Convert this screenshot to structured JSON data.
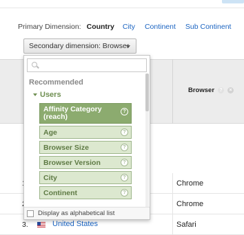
{
  "primary_dimension": {
    "label": "Primary Dimension:",
    "selected": "Country",
    "options": [
      "City",
      "Continent",
      "Sub Continent"
    ]
  },
  "secondary_dimension": {
    "button_label": "Secondary dimension: Browser"
  },
  "dropdown": {
    "search_placeholder": "",
    "section_title": "Recommended",
    "group_title": "Users",
    "items": [
      {
        "label": "Affinity Category (reach)",
        "active": true
      },
      {
        "label": "Age",
        "active": false
      },
      {
        "label": "Browser Size",
        "active": false
      },
      {
        "label": "Browser Version",
        "active": false
      },
      {
        "label": "City",
        "active": false
      },
      {
        "label": "Continent",
        "active": false
      }
    ],
    "footer_checkbox_label": "Display as alphabetical list"
  },
  "table": {
    "header_browser": "Browser",
    "rows": [
      {
        "num": "1.",
        "country": "",
        "browser": "Chrome"
      },
      {
        "num": "2.",
        "country": "",
        "browser": "Chrome"
      },
      {
        "num": "3.",
        "country": "United States",
        "browser": "Safari"
      }
    ]
  },
  "icons": {
    "help": "?",
    "remove": "×"
  }
}
